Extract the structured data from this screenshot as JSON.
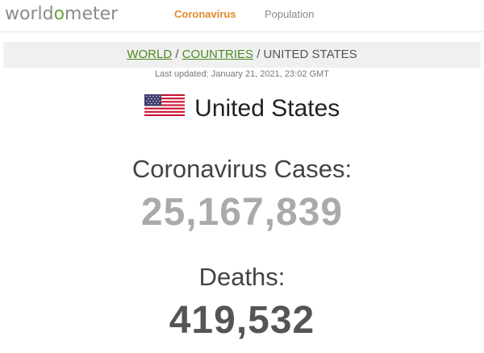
{
  "header": {
    "logo_prefix": "world",
    "logo_o": "o",
    "logo_suffix": "meter",
    "nav": [
      {
        "label": "Coronavirus",
        "active": true
      },
      {
        "label": "Population",
        "active": false
      }
    ]
  },
  "breadcrumb": {
    "world": "WORLD",
    "sep1": " / ",
    "countries": "COUNTRIES",
    "sep2": " / ",
    "current": "UNITED STATES"
  },
  "last_updated": "Last updated: January 21, 2021, 23:02 GMT",
  "country": {
    "name": "United States",
    "flag_icon": "us-flag-icon"
  },
  "stats": {
    "cases_label": "Coronavirus Cases:",
    "cases_value": "25,167,839",
    "deaths_label": "Deaths:",
    "deaths_value": "419,532"
  },
  "colors": {
    "brand_green": "#6aa53b",
    "nav_active": "#e08a2b",
    "cases_value": "#aaaaaa",
    "deaths_value": "#555555",
    "link_green": "#4e8a1f"
  }
}
